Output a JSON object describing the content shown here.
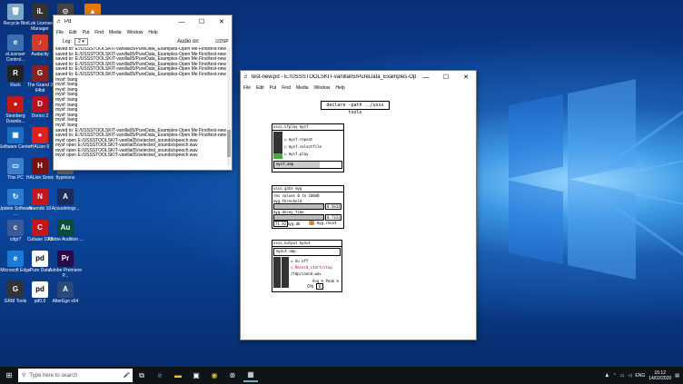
{
  "desktop_icons": [
    {
      "label": "Recycle Bin",
      "color": "#7aa7c7",
      "glyph": "🗑"
    },
    {
      "label": "iLok License Manager",
      "color": "#333333",
      "glyph": "iL"
    },
    {
      "label": "",
      "color": "#444444",
      "glyph": "⊙"
    },
    {
      "label": "",
      "color": "#e07a10",
      "glyph": "▲"
    },
    {
      "label": "eLicenser Control...",
      "color": "#3a6fb0",
      "glyph": "e"
    },
    {
      "label": "Audacity",
      "color": "#d23a2a",
      "glyph": "♪"
    },
    {
      "label": "Rack",
      "color": "#222222",
      "glyph": "R"
    },
    {
      "label": "The Grand 3 64bit",
      "color": "#8b2020",
      "glyph": "G"
    },
    {
      "label": "Steinberg Downlo...",
      "color": "#c21818",
      "glyph": "●"
    },
    {
      "label": "Dorico 2",
      "color": "#b8131d",
      "glyph": "D"
    },
    {
      "label": "Software Center",
      "color": "#1b6ec2",
      "glyph": "▣"
    },
    {
      "label": "HALion 6",
      "color": "#e02020",
      "glyph": "●"
    },
    {
      "label": "This PC",
      "color": "#3c7ec9",
      "glyph": "▭"
    },
    {
      "label": "HALion Sonic",
      "color": "#7a1010",
      "glyph": "H"
    },
    {
      "label": "flypinions",
      "color": "#6a6a6a",
      "glyph": "◎"
    },
    {
      "label": "Update Software ...",
      "color": "#2a7bd0",
      "glyph": "↻"
    },
    {
      "label": "Nuendo 10",
      "color": "#c4161c",
      "glyph": "N"
    },
    {
      "label": "Acoustmogr...",
      "color": "#1a2a5c",
      "glyph": "A"
    },
    {
      "label": "cdgr7",
      "color": "#3a5a9a",
      "glyph": "c"
    },
    {
      "label": "Cubase 10.5",
      "color": "#c4161c",
      "glyph": "C"
    },
    {
      "label": "Adobe Audition ...",
      "color": "#0a4a3a",
      "glyph": "Au"
    },
    {
      "label": "Microsoft Edge",
      "color": "#1a7ad8",
      "glyph": "e"
    },
    {
      "label": "Pure Data",
      "color": "#ffffff",
      "glyph": "pd"
    },
    {
      "label": "Adobe Premiere P...",
      "color": "#2a0a4a",
      "glyph": "Pr"
    },
    {
      "label": "GRM Tools",
      "color": "#333333",
      "glyph": "G"
    },
    {
      "label": "pd0.5",
      "color": "#ffffff",
      "glyph": "pd"
    },
    {
      "label": "AlterEgo x64",
      "color": "#2a4a7a",
      "glyph": "A"
    }
  ],
  "pd_window": {
    "title": "Pd",
    "menu": [
      "File",
      "Edit",
      "Put",
      "Find",
      "Media",
      "Window",
      "Help"
    ],
    "log_label": "Log:",
    "log_value": "2",
    "audio_status": "Audio on",
    "dsp_label": "DSP",
    "console_lines": [
      "saved to: E:/USSSTOOLSKIT-vanilla05/PureData_Examples-Open Me First/test-new.pd",
      "saved to: E:/USSSTOOLSKIT-vanilla05/PureData_Examples-Open Me First/test-new.pd",
      "saved to: E:/USSSTOOLSKIT-vanilla05/PureData_Examples-Open Me First/test-new.pd",
      "saved to: E:/USSSTOOLSKIT-vanilla05/PureData_Examples-Open Me First/test-new.pd",
      "saved to: E:/USSSTOOLSKIT-vanilla05/PureData_Examples-Open Me First/test-new.pd",
      "saved to: E:/USSSTOOLSKIT-vanilla05/PureData_Examples-Open Me First/test-new.pd",
      "mysf: bang",
      "mysf: bang",
      "mysf: bang",
      "mysf: bang",
      "mysf: bang",
      "mysf: bang",
      "mysf: bang",
      "mysf: bang",
      "mysf: bang",
      "mysf: bang",
      "saved to: E:/USSSTOOLSKIT-vanilla05/PureData_Examples-Open Me First/test-new.pd",
      "saved to: E:/USSSTOOLSKIT-vanilla05/PureData_Examples-Open Me First/test-new.pd",
      "mysf open E:/USSSTOOLSKIT-vanilla05/selected_sounds/speech.wav",
      "mysf open E:/USSSTOOLSKIT-vanilla05/selected_sounds/speech.wav",
      "mysf open E:/USSSTOOLSKIT-vanilla05/selected_sounds/speech.wav",
      "mysf open E:/USSSTOOLSKIT-vanilla05/selected_sounds/speech.wav"
    ]
  },
  "patch_window": {
    "title": "test-new.pd - E:/USSSTOOLSKIT-vanilla05/PureData_Examples-Open Me First",
    "menu": [
      "File",
      "Edit",
      "Put",
      "Find",
      "Media",
      "Window",
      "Help"
    ],
    "declare": "declare -path ../usss tools",
    "sfplay": {
      "name": "usss.sfplay mysf",
      "repeat": "mysf.repeat",
      "selectfile": "mysf.selectfile",
      "play": "mysf.play",
      "amp": "mysf.amp"
    },
    "gate": {
      "name": "usss.gate myg",
      "range": "rms values 0 to 100dB",
      "threshold": "myg.threshold",
      "thr_val": "0.5833",
      "decay": "myg.decay_time",
      "dec_val": "0.7331",
      "db_val": "71.92",
      "db_label": "myg.db",
      "reset": "myg.reset"
    },
    "output": {
      "name": "usss.output myout",
      "amp": "myout.amp",
      "off": "éu off",
      "record": "Record_start/stop",
      "file": "/tmp/sound.wav",
      "avg_label": "Avg % Peak %",
      "cpu_label": "CPU",
      "cpu_val": "0"
    }
  },
  "taskbar": {
    "search_placeholder": "Type here to search",
    "lang": "ENG",
    "time": "15:12",
    "date": "14/02/2020"
  }
}
